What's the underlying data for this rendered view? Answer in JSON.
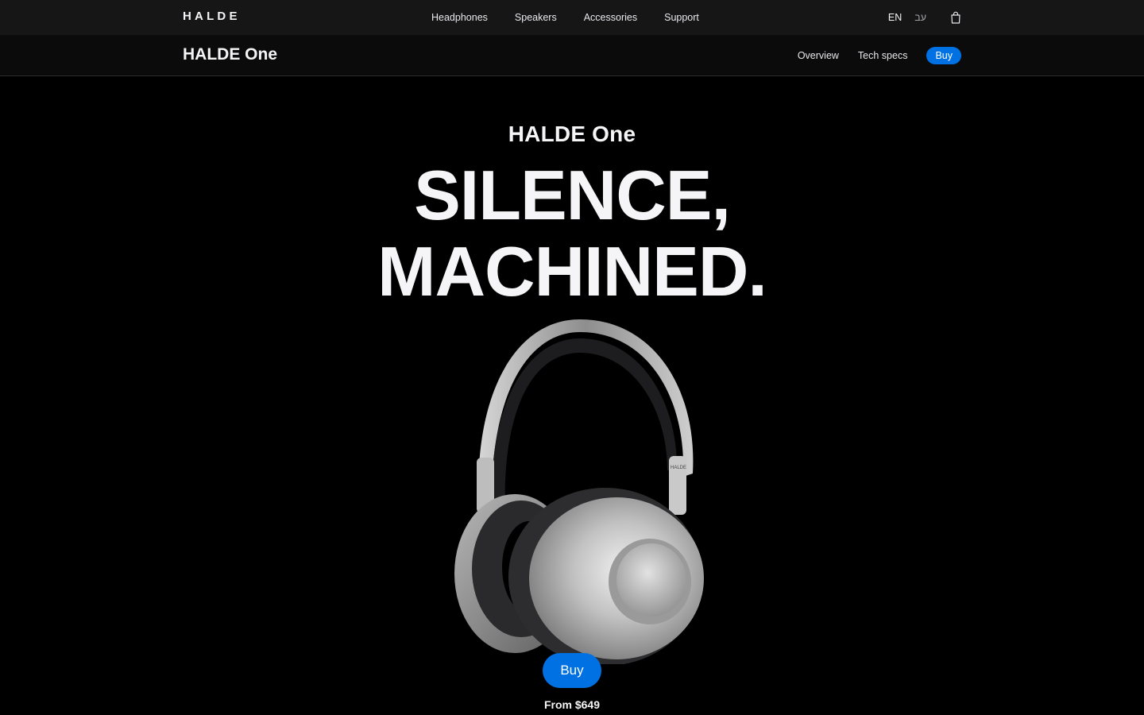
{
  "global_nav": {
    "logo": "HALDE",
    "links": [
      "Headphones",
      "Speakers",
      "Accessories",
      "Support"
    ],
    "lang_active": "EN",
    "lang_alt": "עב",
    "bag_icon": "shopping-bag-icon"
  },
  "local_nav": {
    "title": "HALDE One",
    "links": [
      "Overview",
      "Tech specs"
    ],
    "buy_label": "Buy",
    "accent": "#0071e3"
  },
  "hero": {
    "eyebrow": "HALDE One",
    "headline_line1": "SILENCE,",
    "headline_line2": "MACHINED.",
    "product_engraving": "HALDE",
    "cta_label": "Buy",
    "price_text": "From $649"
  }
}
